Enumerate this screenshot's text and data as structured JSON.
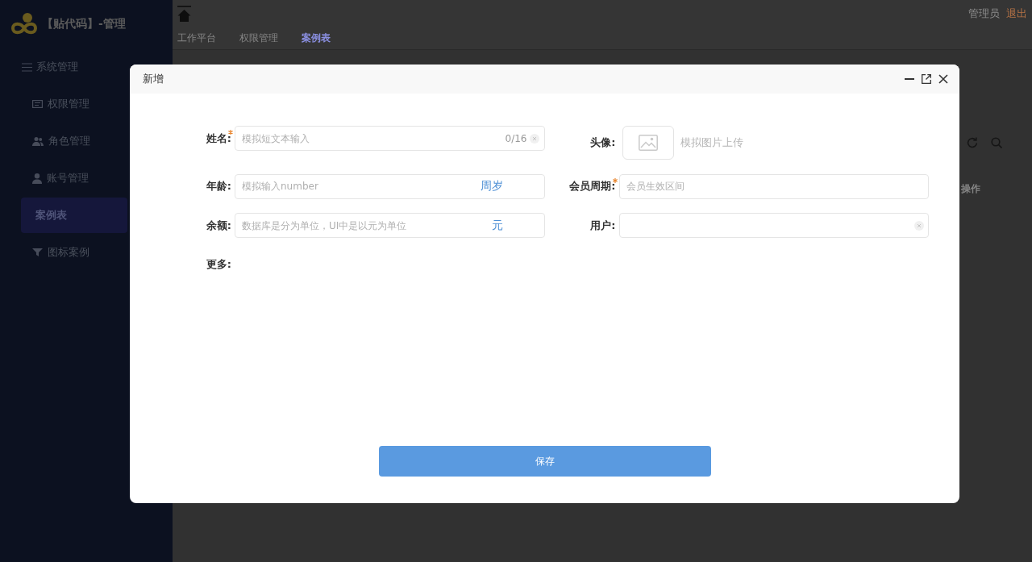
{
  "sidebar": {
    "brand": "【贴代码】-管理",
    "group": "系统管理",
    "items": [
      {
        "label": "权限管理",
        "selected": false
      },
      {
        "label": "角色管理",
        "selected": false
      },
      {
        "label": "账号管理",
        "selected": false
      },
      {
        "label": "案例表",
        "selected": true
      },
      {
        "label": "图标案例",
        "selected": false
      }
    ]
  },
  "header": {
    "tabs": [
      {
        "label": "工作平台",
        "selected": false
      },
      {
        "label": "权限管理",
        "selected": false
      },
      {
        "label": "案例表",
        "selected": true
      }
    ],
    "user": "管理员",
    "logout": "退出"
  },
  "table": {
    "columns": [
      "操作"
    ]
  },
  "dialog": {
    "title": "新增",
    "fields": [
      {
        "kind": "text",
        "label": "姓名:",
        "required": true,
        "placeholder": "模拟短文本输入",
        "counter": "0/16",
        "clearable": true
      },
      {
        "kind": "upload",
        "label": "头像:",
        "required": false,
        "hint": "模拟图片上传"
      },
      {
        "kind": "number",
        "label": "年龄:",
        "required": false,
        "placeholder": "模拟输入number",
        "suffix": "周岁"
      },
      {
        "kind": "daterange",
        "label": "会员周期:",
        "required": true,
        "placeholder": "会员生效区间"
      },
      {
        "kind": "number",
        "label": "余额:",
        "required": false,
        "placeholder": "数据库是分为单位，UI中是以元为单位",
        "suffix": "元"
      },
      {
        "kind": "select",
        "label": "用户:",
        "required": false,
        "clearable": true
      },
      {
        "kind": "custom",
        "label": "更多:",
        "required": false
      }
    ],
    "save_button": "保存"
  }
}
